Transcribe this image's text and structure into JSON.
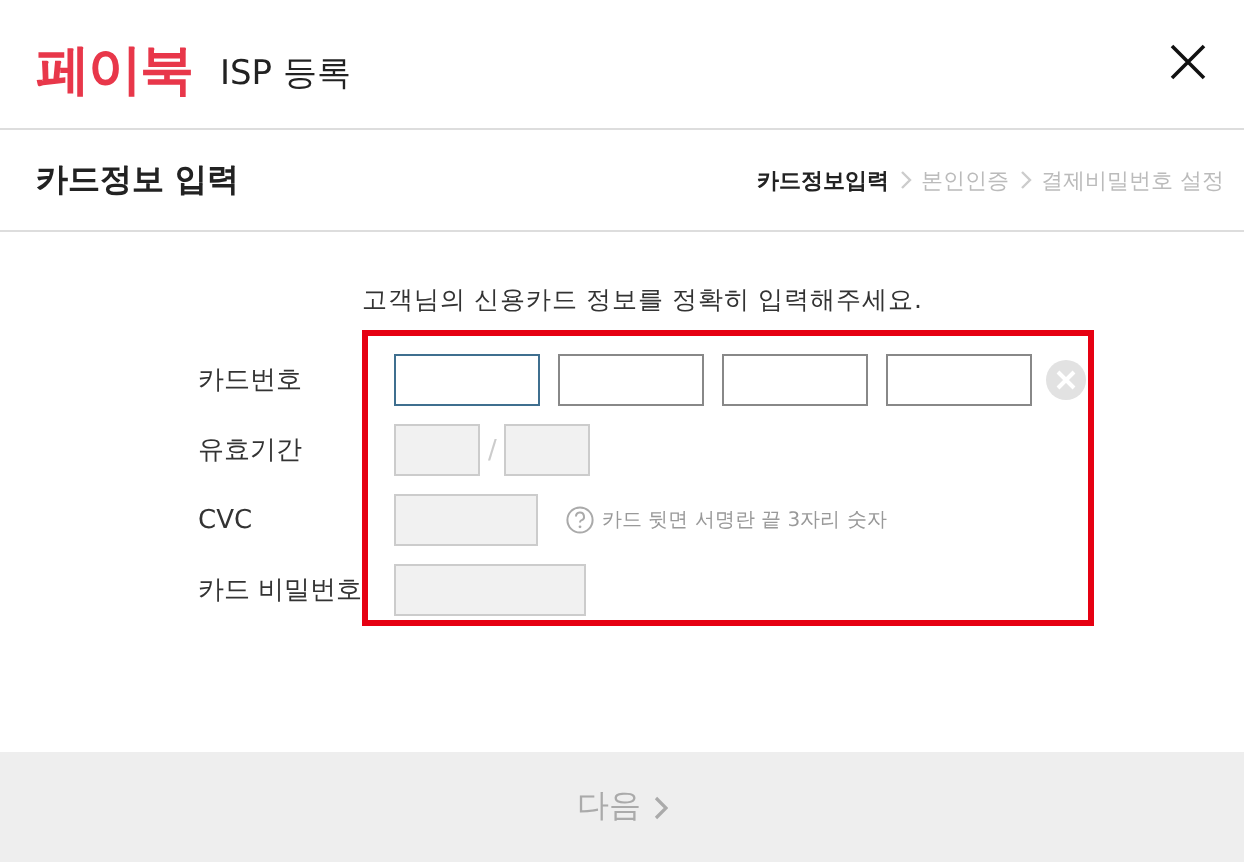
{
  "header": {
    "logo": "페이북",
    "title": "ISP 등록"
  },
  "section": {
    "title": "카드정보 입력",
    "steps": [
      {
        "label": "카드정보입력",
        "selected": true
      },
      {
        "label": "본인인증",
        "selected": false
      },
      {
        "label": "결제비밀번호 설정",
        "selected": false
      }
    ]
  },
  "intro": "고객님의 신용카드 정보를 정확히 입력해주세요.",
  "fields": [
    {
      "kind": "card_number",
      "label": "카드번호",
      "inputs": [
        {
          "focused": true,
          "disabled": false
        },
        {
          "focused": false,
          "disabled": false
        },
        {
          "focused": false,
          "disabled": false
        },
        {
          "focused": false,
          "disabled": false
        }
      ],
      "clear_button": true
    },
    {
      "kind": "expiry",
      "label": "유효기간",
      "separator": "/",
      "inputs": [
        {
          "focused": false,
          "disabled": true
        },
        {
          "focused": false,
          "disabled": true
        }
      ]
    },
    {
      "kind": "cvc",
      "label": "CVC",
      "hint": "카드 뒷면 서명란 끝 3자리 숫자",
      "inputs": [
        {
          "focused": false,
          "disabled": true
        }
      ]
    },
    {
      "kind": "password",
      "label": "카드 비밀번호",
      "inputs": [
        {
          "focused": false,
          "disabled": true
        }
      ]
    }
  ],
  "next_button": {
    "label": "다음",
    "disabled": true
  }
}
